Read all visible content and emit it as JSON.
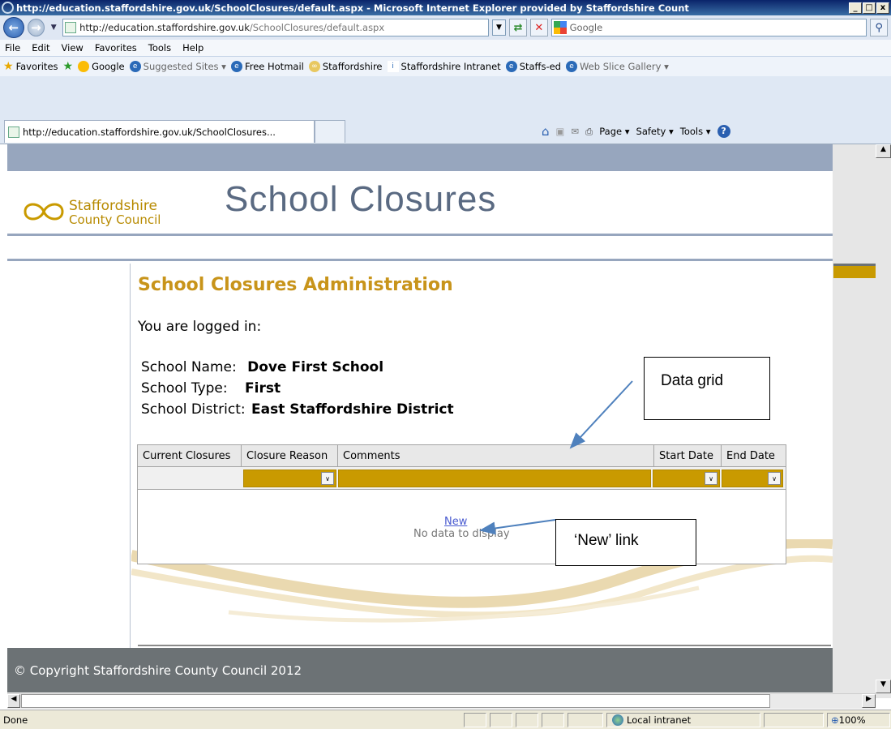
{
  "browser": {
    "title": "http://education.staffordshire.gov.uk/SchoolClosures/default.aspx - Microsoft Internet Explorer provided by Staffordshire Count",
    "address_prefix": "http://education.staffordshire.gov.uk",
    "address_path": "/SchoolClosures/default.aspx",
    "search_placeholder": "Google",
    "menu": [
      "File",
      "Edit",
      "View",
      "Favorites",
      "Tools",
      "Help"
    ],
    "favorites_label": "Favorites",
    "favorites": [
      {
        "label": "Google",
        "icon": "google-icon"
      },
      {
        "label": "Suggested Sites ▾",
        "icon": "ie-icon"
      },
      {
        "label": "Free Hotmail",
        "icon": "ie-icon"
      },
      {
        "label": "Staffordshire",
        "icon": "staffordshire-knot-icon"
      },
      {
        "label": "Staffordshire Intranet",
        "icon": "info-icon"
      },
      {
        "label": "Staffs-ed",
        "icon": "ie-icon"
      },
      {
        "label": "Web Slice Gallery ▾",
        "icon": "ie-icon"
      }
    ],
    "tab_label": "http://education.staffordshire.gov.uk/SchoolClosures...",
    "commands": [
      "Page ▾",
      "Safety ▾",
      "Tools ▾"
    ],
    "status_text": "Done",
    "zone": "Local intranet",
    "zoom": "100%"
  },
  "site": {
    "logo_line1": "Staffordshire",
    "logo_line2": "County Council",
    "title": "School Closures",
    "footer": "© Copyright Staffordshire County Council 2012"
  },
  "admin": {
    "heading": "School Closures Administration",
    "logged_in": "You are logged in:",
    "school_name_label": "School Name:",
    "school_name": "Dove First School",
    "school_type_label": "School Type:",
    "school_type": "First",
    "school_district_label": "School District:",
    "school_district": "East Staffordshire District"
  },
  "grid": {
    "columns": [
      "Current Closures",
      "Closure Reason",
      "Comments",
      "Start Date",
      "End Date"
    ],
    "new_link": "New",
    "empty_text": "No data to display"
  },
  "annotations": {
    "data_grid": "Data grid",
    "new_link": "‘New’ link"
  },
  "colors": {
    "accent_gold": "#c99a00",
    "header_band": "#97a6be",
    "footer": "#6c7275"
  }
}
